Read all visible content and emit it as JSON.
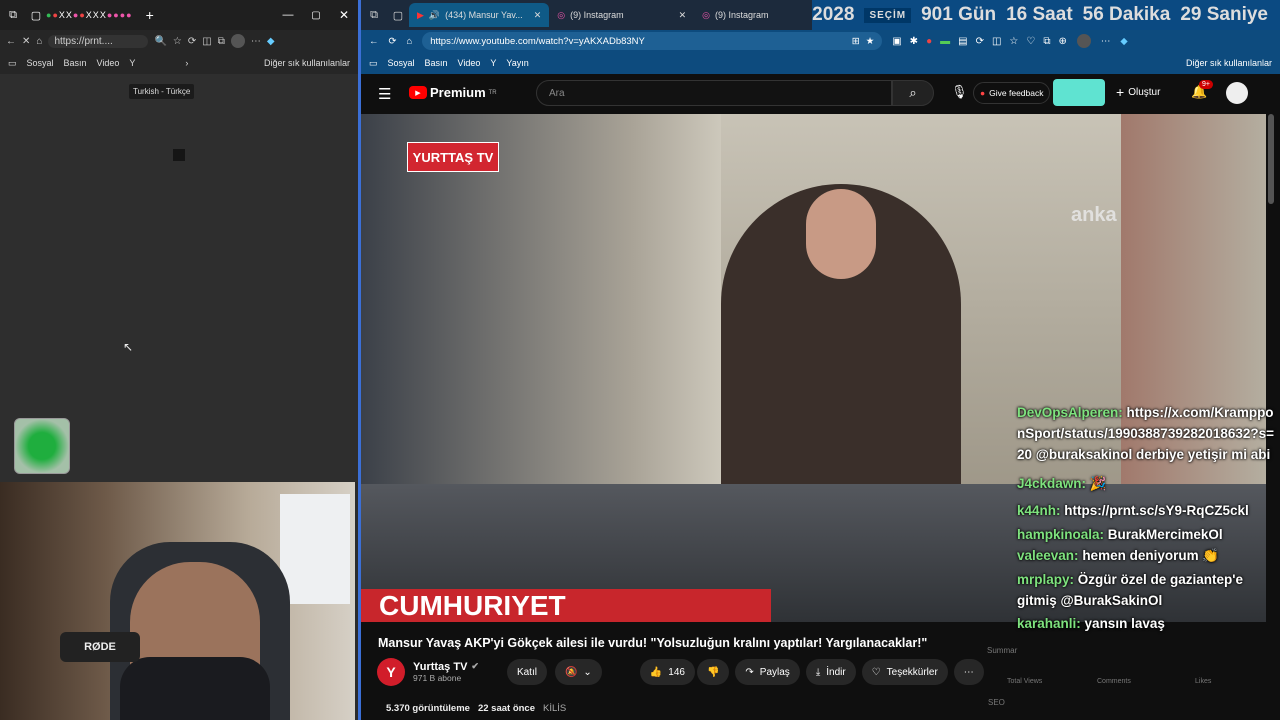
{
  "left_browser": {
    "url": "https://prnt....",
    "bookmarks": [
      "Sosyal",
      "Basın",
      "Video",
      "Y"
    ],
    "bookmarks_other": "Diğer sık kullanılanlar",
    "tooltip": "Turkish - Türkçe"
  },
  "right_browser": {
    "tabs": [
      {
        "label": "(434) Mansur Yav...",
        "active": true
      },
      {
        "label": "(9) Instagram",
        "active": false
      },
      {
        "label": "(9) Instagram",
        "active": false
      }
    ],
    "url": "https://www.youtube.com/watch?v=yAKXADb83NY",
    "bookmarks": [
      "Sosyal",
      "Basın",
      "Video",
      "Y",
      "Yayın"
    ],
    "bookmarks_other": "Diğer sık kullanılanlar"
  },
  "countdown": {
    "year": "2028",
    "badge": "SEÇİM",
    "days": "901 Gün",
    "hours": "16 Saat",
    "minutes": "56 Dakika",
    "seconds": "29 Saniye"
  },
  "youtube": {
    "logo": "Premium",
    "logo_sup": "TR",
    "search_placeholder": "Ara",
    "feedback": "Give feedback",
    "create": "Oluştur",
    "notif_count": "9+",
    "video_logo": "YURTTAŞ TV",
    "watermark": "anka",
    "banner": "CUMHURIYET",
    "title": "Mansur Yavaş AKP'yi Gökçek ailesi ile vurdu! \"Yolsuzluğun kralını yaptılar! Yargılanacaklar!\"",
    "channel": "Yurttaş TV",
    "subscribers": "971 B abone",
    "join": "Katıl",
    "likes": "146",
    "share": "Paylaş",
    "download": "İndir",
    "thanks": "Teşekkürler",
    "views": "5.370 görüntüleme",
    "time_ago": "22 saat önce",
    "location": "KİLİS",
    "side_labels": [
      "Summar",
      "Total Views",
      "Comments",
      "Likes",
      "SEO"
    ]
  },
  "chat": [
    {
      "user": "DevOpsAlperen:",
      "text": "https://x.com/KrampponSport/status/1990388739282018632?s=20 @buraksakinol derbiye yetişir mi abi"
    },
    {
      "user": "J4ckdawn:",
      "text": "🎉"
    },
    {
      "user": "k44nh:",
      "text": "https://prnt.sc/sY9-RqCZ5ckl"
    },
    {
      "user": "hampkinoala:",
      "text": "BurakMercimekOl"
    },
    {
      "user": "valeevan:",
      "text": "hemen deniyorum 👏"
    },
    {
      "user": "mrplapy:",
      "text": "Özgür özel de gaziantep'e gitmiş @BurakSakinOl"
    },
    {
      "user": "karahanli:",
      "text": "yansın lavaş"
    }
  ],
  "webcam": {
    "mic_brand": "RØDE"
  }
}
